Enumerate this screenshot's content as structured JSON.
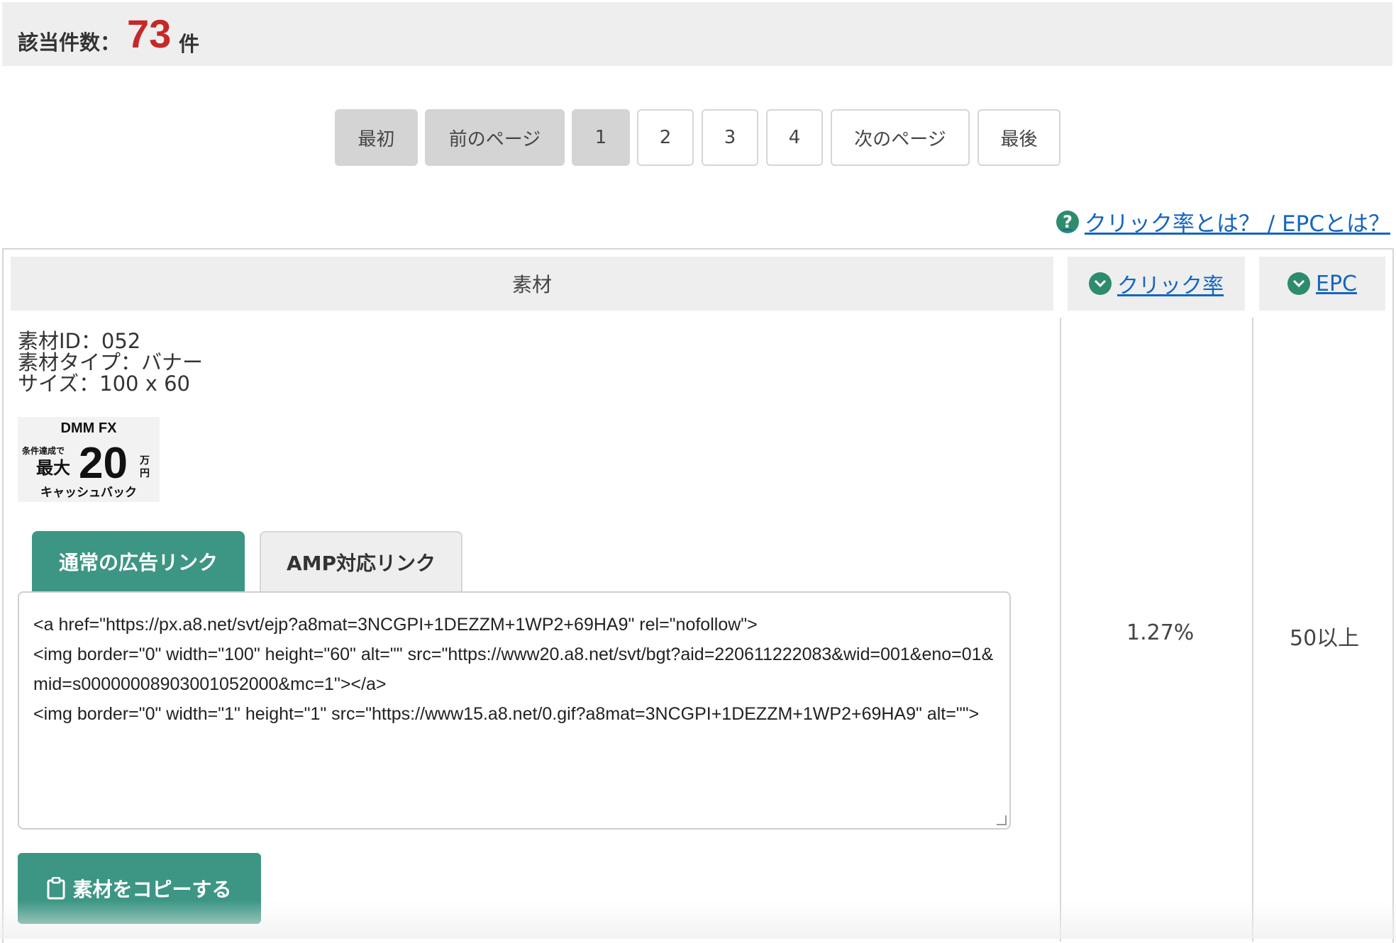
{
  "result": {
    "label": "該当件数：",
    "count": "73",
    "unit": "件"
  },
  "pagination": {
    "first": "最初",
    "prev": "前のページ",
    "pages": [
      "1",
      "2",
      "3",
      "4"
    ],
    "next": "次のページ",
    "last": "最後"
  },
  "help": {
    "icon": "question-icon",
    "text": "クリック率とは？ / EPCとは？"
  },
  "table": {
    "headers": {
      "material": "素材",
      "click_rate": "クリック率",
      "epc": "EPC"
    },
    "row": {
      "material_id": "素材ID：052",
      "material_type": "素材タイプ：バナー",
      "size": "サイズ：100 x 60",
      "banner": {
        "brand": "DMM FX",
        "line1": "条件達成で",
        "big_prefix": "最大",
        "amount": "20",
        "amount_unit_top": "万",
        "amount_unit_bottom": "円",
        "footer": "キャッシュバック"
      },
      "tabs": {
        "normal": "通常の広告リンク",
        "amp": "AMP対応リンク"
      },
      "code": "<a href=\"https://px.a8.net/svt/ejp?a8mat=3NCGPI+1DEZZM+1WP2+69HA9\" rel=\"nofollow\">\n<img border=\"0\" width=\"100\" height=\"60\" alt=\"\" src=\"https://www20.a8.net/svt/bgt?aid=220611222083&wid=001&eno=01&mid=s00000008903001052000&mc=1\"></a>\n<img border=\"0\" width=\"1\" height=\"1\" src=\"https://www15.a8.net/0.gif?a8mat=3NCGPI+1DEZZM+1WP2+69HA9\" alt=\"\">",
      "copy_button": "素材をコピーする",
      "click_rate": "1.27%",
      "epc": "50以上"
    }
  },
  "colors": {
    "accent": "#3c9683",
    "count": "#c62828",
    "link": "#1565c0"
  }
}
